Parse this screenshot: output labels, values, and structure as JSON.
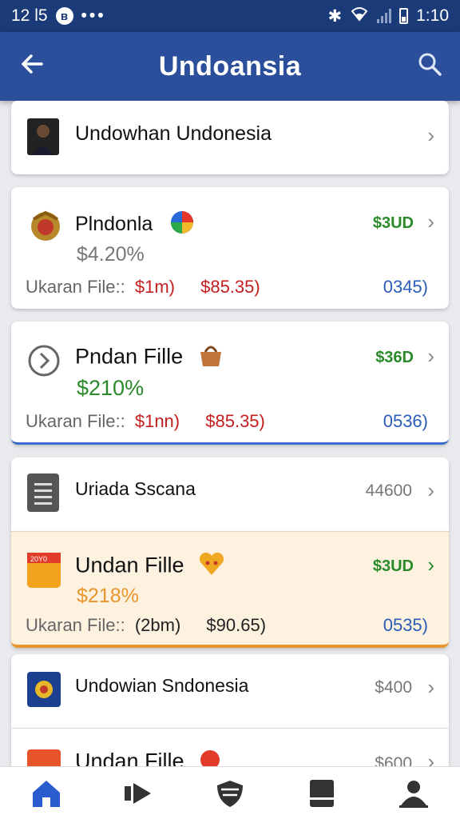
{
  "status_bar": {
    "time_left": "12 l5",
    "dots": "•••",
    "time_right": "1:10",
    "bt_label": "ʙ"
  },
  "app_bar": {
    "title": "Undoansia",
    "back_icon": "arrow-left-icon",
    "search_icon": "search-icon"
  },
  "items": [
    {
      "title": "Undowhan Undonesia"
    },
    {
      "title": "Plndonla",
      "amount": "$3UD",
      "percent": "$4.20%",
      "meta_label": "Ukaran File::",
      "meta_v1": "$1m)",
      "meta_v2": "$85.35)",
      "code": "0345)"
    },
    {
      "title": "Pndan Fille",
      "amount": "$36D",
      "percent": "$210%",
      "meta_label": "Ukaran File::",
      "meta_v1": "$1nn)",
      "meta_v2": "$85.35)",
      "code": "0536)"
    },
    {
      "title": "Uriada Sscana",
      "amount": "44600"
    },
    {
      "title": "Undan Fille",
      "amount": "$3UD",
      "percent": "$218%",
      "meta_label": "Ukaran File::",
      "meta_v1": "(2bm)",
      "meta_v2": "$90.65)",
      "code": "0535)"
    },
    {
      "title": "Undowian Sndonesia",
      "amount": "$400"
    },
    {
      "title": "Undan Fille",
      "amount": "$600"
    }
  ],
  "bottom_nav": [
    "home-icon",
    "play-icon",
    "shield-icon",
    "document-icon",
    "profile-icon"
  ],
  "colors": {
    "header": "#2b4f9a",
    "status": "#1a3a78",
    "green": "#2a8a2a",
    "red": "#c41d1d",
    "blue": "#2a5cb8",
    "orange": "#e8962e"
  }
}
